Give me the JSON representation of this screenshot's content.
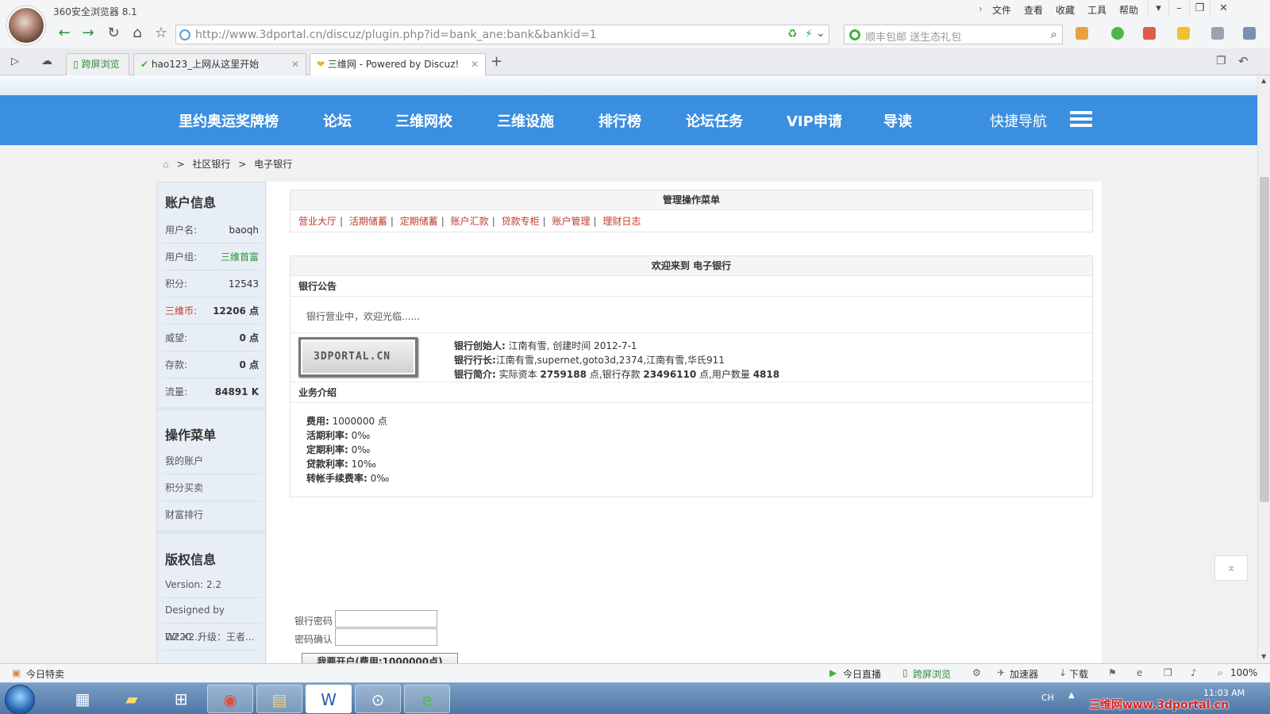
{
  "browser": {
    "app_title": "360安全浏览器 8.1",
    "menus": [
      "文件",
      "查看",
      "收藏",
      "工具",
      "帮助"
    ],
    "url": "http://www.3dportal.cn/discuz/plugin.php?id=bank_ane:bank&bankid=1",
    "search_placeholder": "顺丰包邮 送生态礼包",
    "tabs": [
      {
        "label": "跨屏浏览"
      },
      {
        "label": "hao123_上网从这里开始"
      },
      {
        "label": "三维网 - Powered by Discuz!"
      }
    ],
    "new_tab": "+"
  },
  "site_nav": {
    "items": [
      "里约奥运奖牌榜",
      "论坛",
      "三维网校",
      "三维设施",
      "排行榜",
      "论坛任务",
      "VIP申请",
      "导读"
    ],
    "quick_nav": "快捷导航"
  },
  "breadcrumb": {
    "sep": ">",
    "items": [
      "社区银行",
      "电子银行"
    ]
  },
  "sidebar": {
    "account_title": "账户信息",
    "account_rows": [
      {
        "key": "用户名:",
        "value": "baoqh"
      },
      {
        "key": "用户组:",
        "value": "三维首富"
      },
      {
        "key": "积分:",
        "value": "12543"
      },
      {
        "key": "三维币:",
        "value": "12206 点"
      },
      {
        "key": "威望:",
        "value": "0 点"
      },
      {
        "key": "存款:",
        "value": "0 点"
      },
      {
        "key": "流量:",
        "value": "84891 K"
      }
    ],
    "menu_title": "操作菜单",
    "menu_items": [
      "我的账户",
      "积分买卖",
      "财富排行"
    ],
    "copyright_title": "版权信息",
    "copyright_items": [
      "Version: 2.2",
      "Designed by Wz20...",
      "DZ X2 升级：王者..."
    ]
  },
  "main": {
    "admin_menu_title": "管理操作菜单",
    "admin_links": [
      "营业大厅",
      "活期储蓄",
      "定期储蓄",
      "账户汇款",
      "贷款专柜",
      "账户管理",
      "理财日志"
    ],
    "welcome_title": "欢迎来到 电子银行",
    "notice_title": "银行公告",
    "notice_text": "银行营业中，欢迎光临......",
    "logo_text": "3DPORTAL.CN",
    "founder_label": "银行创始人:",
    "founder_value": "江南有雪, 创建时间 2012-7-1",
    "president_label": "银行行长:",
    "president_value": "江南有雪,supernet,goto3d,2374,江南有雪,华氏911",
    "intro_label": "银行简介:",
    "intro_prefix": "实际资本",
    "capital": "2759188",
    "intro_mid": "点,银行存款",
    "deposits": "23496110",
    "intro_users": "点,用户数量",
    "users": "4818",
    "business_title": "业务介绍",
    "fees": [
      {
        "label": "费用:",
        "value": "1000000 点"
      },
      {
        "label": "活期利率:",
        "value": "0‰"
      },
      {
        "label": "定期利率:",
        "value": "0‰"
      },
      {
        "label": "贷款利率:",
        "value": "10‰"
      },
      {
        "label": "转帐手续费率:",
        "value": "0‰"
      }
    ],
    "password_label": "银行密码",
    "confirm_label": "密码确认",
    "open_button": "我要开户(费用:1000000点)"
  },
  "statusbar": {
    "left": "今日特卖",
    "items": [
      "今日直播",
      "跨屏浏览",
      "加速器",
      "下载"
    ],
    "zoom": "100%"
  },
  "taskbar": {
    "lang": "CH",
    "time": "11:03 AM"
  },
  "watermark": "三维网www.3dportal.cn",
  "colors": {
    "nav_blue": "#3b8fe0",
    "link_red": "#c0392b",
    "green": "#2d8d39"
  }
}
